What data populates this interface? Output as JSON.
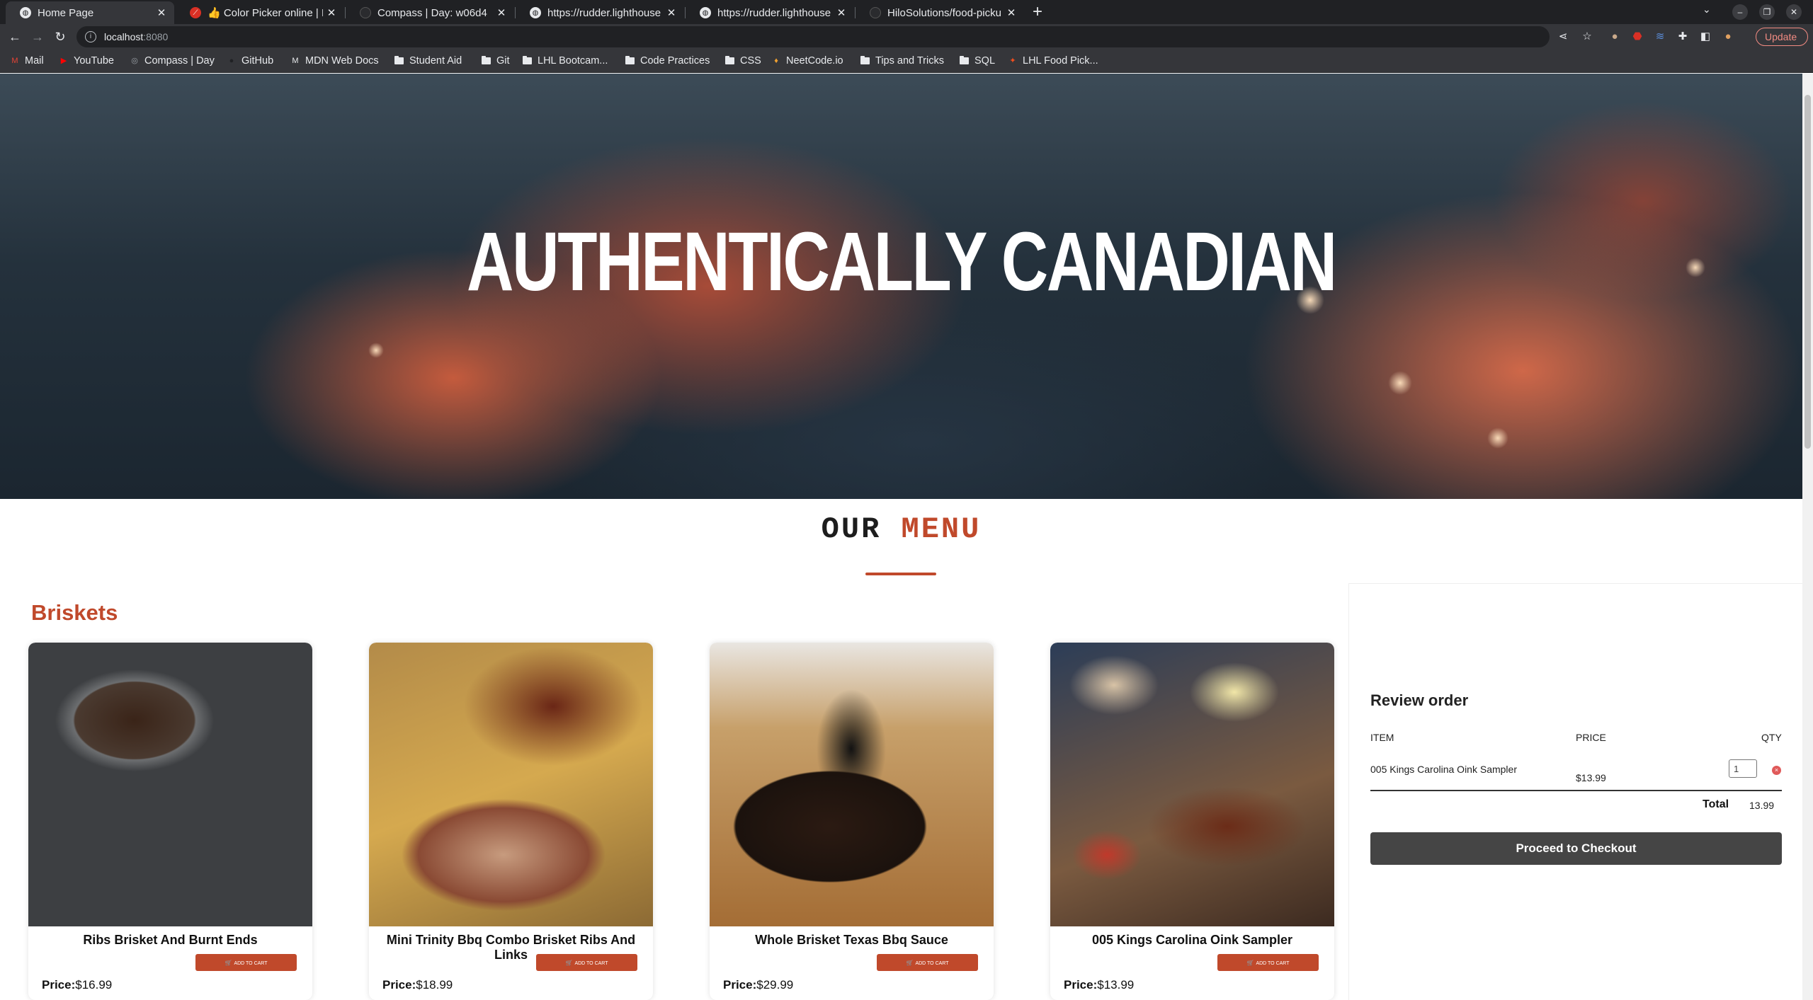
{
  "browser": {
    "tabs": [
      {
        "title": "Home Page",
        "active": true
      },
      {
        "title": "👍 Color Picker online | HT"
      },
      {
        "title": "Compass | Day: w06d4"
      },
      {
        "title": "https://rudder.lighthouse"
      },
      {
        "title": "https://rudder.lighthouse"
      },
      {
        "title": "HiloSolutions/food-picku"
      }
    ],
    "address": {
      "host": "localhost",
      "port": ":8080"
    },
    "update_label": "Update",
    "bookmarks": [
      {
        "label": "Mail",
        "icon": "gmail-icon"
      },
      {
        "label": "YouTube",
        "icon": "youtube-icon"
      },
      {
        "label": "Compass | Day",
        "icon": "compass-icon"
      },
      {
        "label": "GitHub",
        "icon": "github-icon"
      },
      {
        "label": "MDN Web Docs",
        "icon": "mdn-icon"
      },
      {
        "label": "Student Aid",
        "icon": "folder-icon"
      },
      {
        "label": "Git",
        "icon": "folder-icon"
      },
      {
        "label": "LHL Bootcam...",
        "icon": "folder-icon"
      },
      {
        "label": "Code Practices",
        "icon": "folder-icon"
      },
      {
        "label": "CSS",
        "icon": "folder-icon"
      },
      {
        "label": "NeetCode.io",
        "icon": "neetcode-icon"
      },
      {
        "label": "Tips and Tricks",
        "icon": "folder-icon"
      },
      {
        "label": "SQL",
        "icon": "folder-icon"
      },
      {
        "label": "LHL Food Pick...",
        "icon": "figma-icon"
      }
    ]
  },
  "hero": {
    "title": "AUTHENTICALLY CANADIAN"
  },
  "menu": {
    "heading_word1": "OUR",
    "heading_word2": "MENU",
    "section": "Briskets",
    "price_label": "Price:",
    "add_label": "ADD TO CART",
    "items": [
      {
        "name": "Ribs Brisket And Burnt Ends",
        "price": "$16.99"
      },
      {
        "name": "Mini Trinity Bbq Combo Brisket Ribs And Links",
        "price": "$18.99"
      },
      {
        "name": "Whole Brisket Texas Bbq Sauce",
        "price": "$29.99"
      },
      {
        "name": "005 Kings Carolina Oink Sampler",
        "price": "$13.99"
      }
    ]
  },
  "review": {
    "title": "Review order",
    "columns": {
      "item": "ITEM",
      "price": "PRICE",
      "qty": "QTY"
    },
    "rows": [
      {
        "item": "005 Kings Carolina Oink Sampler",
        "price": "$13.99",
        "qty": "1"
      }
    ],
    "total_label": "Total",
    "total_value": "13.99",
    "checkout_label": "Proceed to Checkout"
  },
  "colors": {
    "accent": "#c0492b",
    "checkout_button": "#454545",
    "remove_dot": "#e05a5a"
  }
}
